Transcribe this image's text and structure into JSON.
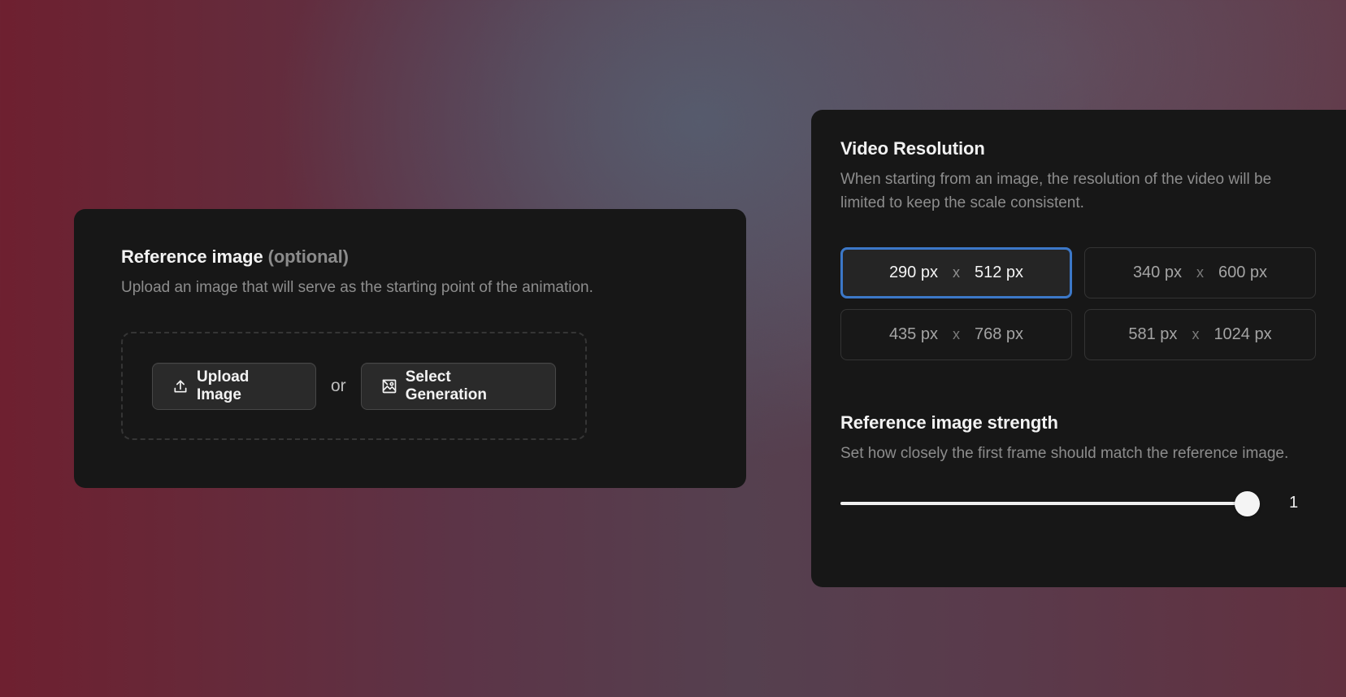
{
  "reference_image": {
    "title": "Reference image",
    "optional_label": "(optional)",
    "description": "Upload an image that will serve as the starting point of the animation.",
    "upload_button_label": "Upload Image",
    "or_label": "or",
    "select_generation_label": "Select Generation"
  },
  "video_resolution": {
    "title": "Video Resolution",
    "description": "When starting from an image, the resolution of the video will be limited to keep the scale consistent.",
    "options": [
      {
        "width": "290 px",
        "separator": "x",
        "height": "512 px",
        "selected": true
      },
      {
        "width": "340 px",
        "separator": "x",
        "height": "600 px",
        "selected": false
      },
      {
        "width": "435 px",
        "separator": "x",
        "height": "768 px",
        "selected": false
      },
      {
        "width": "581 px",
        "separator": "x",
        "height": "1024 px",
        "selected": false
      }
    ]
  },
  "reference_strength": {
    "title": "Reference image strength",
    "description": "Set how closely the first frame should match the reference image.",
    "value": "1",
    "fill_fraction": 1
  },
  "colors": {
    "selected_border": "#3c78c8",
    "panel_background": "#171717",
    "muted_text": "#8d8d8d"
  },
  "icons": {
    "upload": "upload-icon",
    "select_generation": "image-gallery-icon"
  }
}
